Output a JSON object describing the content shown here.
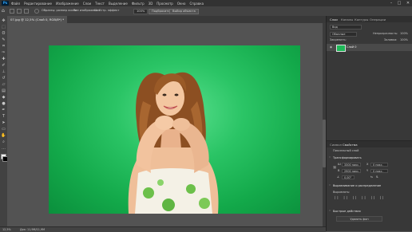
{
  "app": {
    "logo": "Ps"
  },
  "menu": {
    "items": [
      "Файл",
      "Редактирование",
      "Изображение",
      "Слои",
      "Текст",
      "Выделение",
      "Фильтр",
      "3D",
      "Просмотр",
      "Окно",
      "Справка"
    ]
  },
  "options": {
    "sample_label": "Образец: размер кисти",
    "sample_all_label": "Все изображения",
    "erase_label": "Устр. эффект",
    "percent": "100%",
    "refine_button": "Подбросить",
    "select_subject_button": "Выбор объекта",
    "mask_button": "Уточнить маску"
  },
  "document": {
    "tab_label": "07.jpg @ 12,5% (Слой 0, RGB/8*) *"
  },
  "status": {
    "zoom": "12,5%",
    "doc_info": "Док: 11,9M/11,9M"
  },
  "panel": {
    "tabs": [
      "Слои",
      "Каналы",
      "Контуры",
      "Операции"
    ],
    "search_label": "Вид",
    "blend_mode": "Обычные",
    "opacity_label": "Непрозрачность:",
    "opacity_value": "100%",
    "lock_label": "Закрепить:",
    "fill_label": "Заливка:",
    "fill_value": "100%",
    "layer_name": "Слой 0",
    "props_tabs": [
      "Символ",
      "Свойства"
    ],
    "pixel_layer_label": "Пиксельный слой",
    "transform_header": "Трансформировать",
    "w_label": "Ш",
    "w_value": "3300 пикс.",
    "h_label": "В",
    "h_value": "2900 пикс.",
    "x_label": "X",
    "x_value": "0 пикс.",
    "y_label": "Y",
    "y_value": "0 пикс.",
    "angle_value": "0,00°",
    "align_header": "Выравнивание и распределение",
    "align_label": "Выровнять:",
    "quick_header": "Быстрые действия",
    "remove_bg_button": "Удалить фон"
  },
  "colors": {
    "menubar": "#323232",
    "panel": "#383838",
    "canvas_bg": "#535353",
    "green_screen": "#13a94a",
    "ps_blue": "#31a8ff"
  },
  "icons": [
    "move-icon",
    "marquee-icon",
    "lasso-icon",
    "quick-select-icon",
    "crop-icon",
    "eyedropper-icon",
    "healing-icon",
    "brush-icon",
    "stamp-icon",
    "history-brush-icon",
    "eraser-icon",
    "gradient-icon",
    "blur-icon",
    "dodge-icon",
    "pen-icon",
    "type-icon",
    "path-select-icon",
    "shape-icon",
    "hand-icon",
    "zoom-icon"
  ]
}
